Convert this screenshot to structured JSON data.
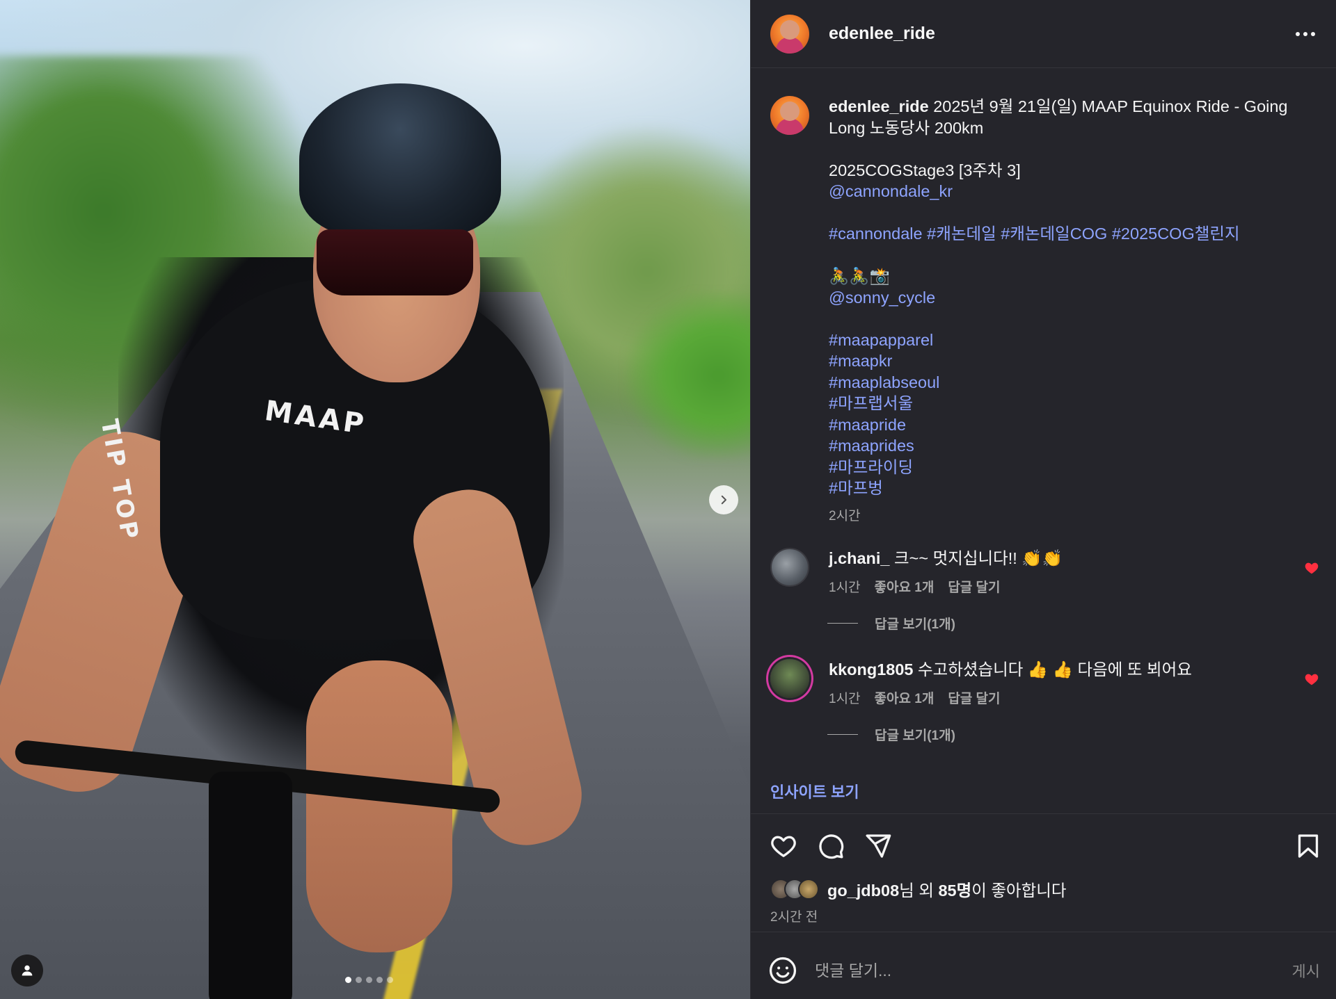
{
  "post": {
    "author": "edenlee_ride",
    "caption": {
      "line1": "2025년 9월 21일(일) MAAP Equinox Ride - Going Long 노동당사 200km",
      "line2": "2025COGStage3 [3주차 3]",
      "mention1": "@cannondale_kr",
      "tags_row": [
        "#cannondale",
        "#캐논데일",
        "#캐논데일COG",
        "#2025COG챌린지"
      ],
      "emoji_line": "🚴🚴📸",
      "mention2": "@sonny_cycle",
      "tags_list": [
        "#maapapparel",
        "#maapkr",
        "#maaplabseoul",
        "#마프랩서울",
        "#maapride",
        "#maaprides",
        "#마프라이딩",
        "#마프벙"
      ],
      "time": "2시간"
    },
    "comments": [
      {
        "user": "j.chani_",
        "text": "크~~ 멋지십니다!! 👏👏",
        "time": "1시간",
        "likes": "좋아요 1개",
        "reply": "답글 달기",
        "view_replies": "답글 보기(1개)",
        "liked": true
      },
      {
        "user": "kkong1805",
        "text": "수고하셨습니다 👍 👍 다음에 또 뵈어요",
        "time": "1시간",
        "likes": "좋아요 1개",
        "reply": "답글 달기",
        "view_replies": "답글 보기(1개)",
        "liked": true
      }
    ],
    "insights_label": "인사이트 보기",
    "likes": {
      "user": "go_jdb08",
      "suffix1": "님 외 ",
      "count": "85명",
      "suffix2": "이 좋아합니다"
    },
    "posted_time": "2시간 전",
    "comment_input": {
      "placeholder": "댓글 달기...",
      "post_label": "게시"
    }
  },
  "photo": {
    "jersey_text": "MAAP",
    "sleeve_text": "TIP TOP",
    "carousel_dots": 5,
    "active_dot": 0
  },
  "colors": {
    "panel_bg": "#25252b",
    "link": "#8ea4ff",
    "heart_red": "#ff3040",
    "muted": "#a8a8a8"
  },
  "icons": [
    "chevron-right-icon",
    "user-tag-icon",
    "more-icon",
    "heart-icon",
    "comment-icon",
    "share-icon",
    "bookmark-icon",
    "emoji-icon"
  ]
}
